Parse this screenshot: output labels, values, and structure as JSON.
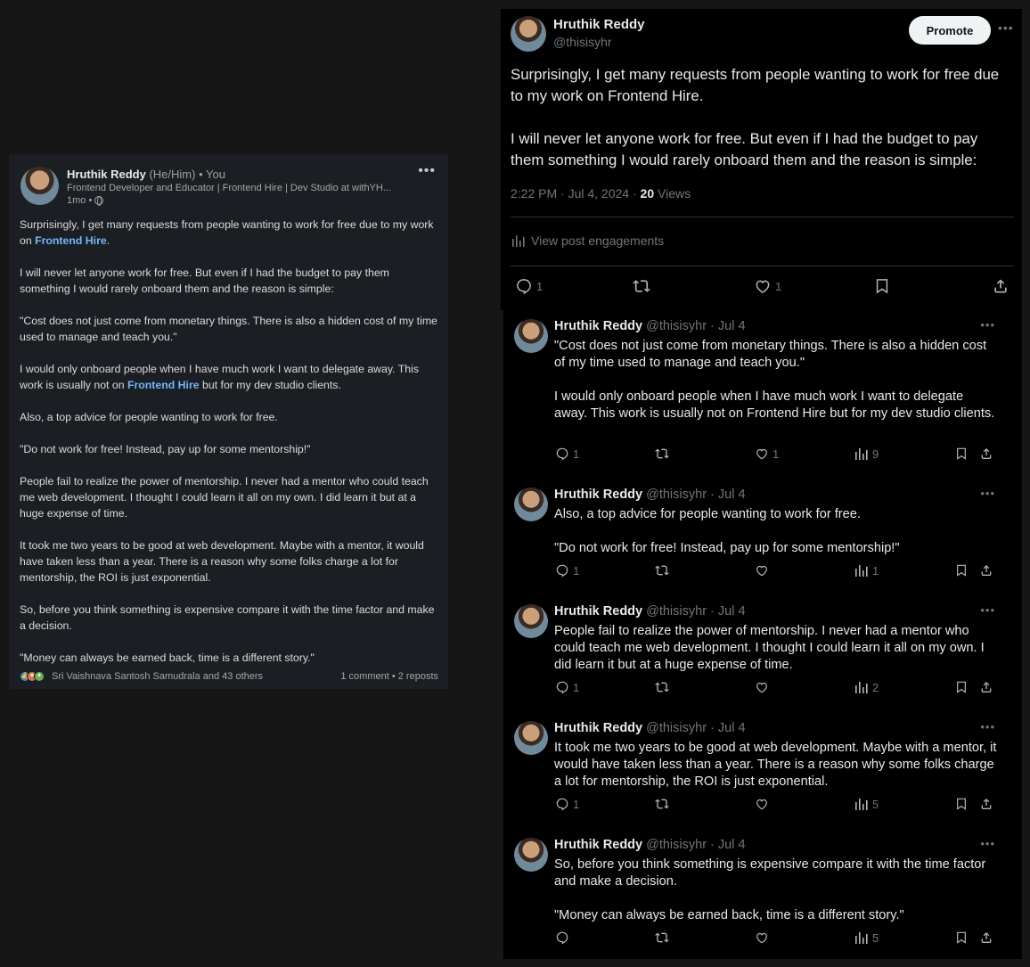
{
  "linkedin": {
    "author_name": "Hruthik Reddy",
    "pronouns": "(He/Him)",
    "relation": "• You",
    "headline": "Frontend Developer and Educator | Frontend Hire | Dev Studio at withYH...",
    "time": "1mo •",
    "more": "•••",
    "paragraphs": {
      "p1_text": "Surprisingly, I get many requests from people wanting to work for free due to my work on ",
      "p1_link": "Frontend Hire",
      "p1_end": ".",
      "p2": "I will never let anyone work for free. But even if I had the budget to pay them something I would rarely onboard them and the reason is simple:",
      "p3": "\"Cost does not just come from monetary things. There is also a hidden cost of my time used to manage and teach you.\"",
      "p4_text": "I would only onboard people when I have much work I want to delegate away. This work is usually not on ",
      "p4_link": "Frontend Hire",
      "p4_end": " but for my dev studio clients.",
      "p5": "Also, a top advice for people wanting to work for free.",
      "p6": "\"Do not work for free! Instead, pay up for some mentorship!\"",
      "p7": "People fail to realize the power of mentorship. I never had a mentor who could teach me web development. I thought I could learn it all on my own. I did learn it but at a huge expense of time.",
      "p8": "It took me two years to be good at web development. Maybe with a mentor, it would have taken less than a year. There is a reason why some folks charge a lot for mentorship, the ROI is just exponential.",
      "p9": "So, before you think something is expensive compare it with the time factor and make a decision.",
      "p10": "\"Money can always be earned back, time is a different story.\""
    },
    "reactions_text": "Sri Vaishnava Santosh Samudrala and 43 others",
    "comments_reposts": "1 comment • 2 reposts"
  },
  "twitter_main": {
    "name": "Hruthik Reddy",
    "handle": "@thisisyhr",
    "promote_label": "Promote",
    "more": "•••",
    "para1": "Surprisingly, I get many requests from people wanting to work for free due to my work on Frontend Hire.",
    "para2": "I will never let anyone work for free. But even if I had the budget to pay them something I would rarely onboard them and the reason is simple:",
    "meta_time": "2:22 PM · Jul 4, 2024 · ",
    "meta_views_count": "20",
    "meta_views_label": " Views",
    "engagements_label": "View post engagements",
    "reply_count": "1",
    "like_count": "1"
  },
  "replies": [
    {
      "name": "Hruthik Reddy",
      "handle_date": "@thisisyhr · Jul 4",
      "paras": [
        "\"Cost does not just come from monetary things. There is also a hidden cost of my time used to manage and teach you.\"",
        "I would only onboard people when I have much work I want to delegate away. This work is usually not on Frontend Hire but for my dev studio clients."
      ],
      "reply_count": "1",
      "like_count": "1",
      "views": "9"
    },
    {
      "name": "Hruthik Reddy",
      "handle_date": "@thisisyhr · Jul 4",
      "paras": [
        "Also, a top advice for people wanting to work for free.",
        "\"Do not work for free! Instead, pay up for some mentorship!\""
      ],
      "reply_count": "1",
      "like_count": "",
      "views": "1"
    },
    {
      "name": "Hruthik Reddy",
      "handle_date": "@thisisyhr · Jul 4",
      "paras": [
        "People fail to realize the power of mentorship. I never had a mentor who could teach me web development. I thought I could learn it all on my own. I did learn it but at a huge expense of time."
      ],
      "reply_count": "1",
      "like_count": "",
      "views": "2"
    },
    {
      "name": "Hruthik Reddy",
      "handle_date": "@thisisyhr · Jul 4",
      "paras": [
        "It took me two years to be good at web development. Maybe with a mentor, it would have taken less than a year. There is a reason why some folks charge a lot for mentorship, the ROI is just exponential."
      ],
      "reply_count": "1",
      "like_count": "",
      "views": "5"
    },
    {
      "name": "Hruthik Reddy",
      "handle_date": "@thisisyhr · Jul 4",
      "paras": [
        "So, before you think something is expensive compare it with the time factor and make a decision.",
        "\"Money can always be earned back, time is a different story.\""
      ],
      "reply_count": "",
      "like_count": "",
      "views": "5"
    }
  ],
  "reply_more": "•••"
}
